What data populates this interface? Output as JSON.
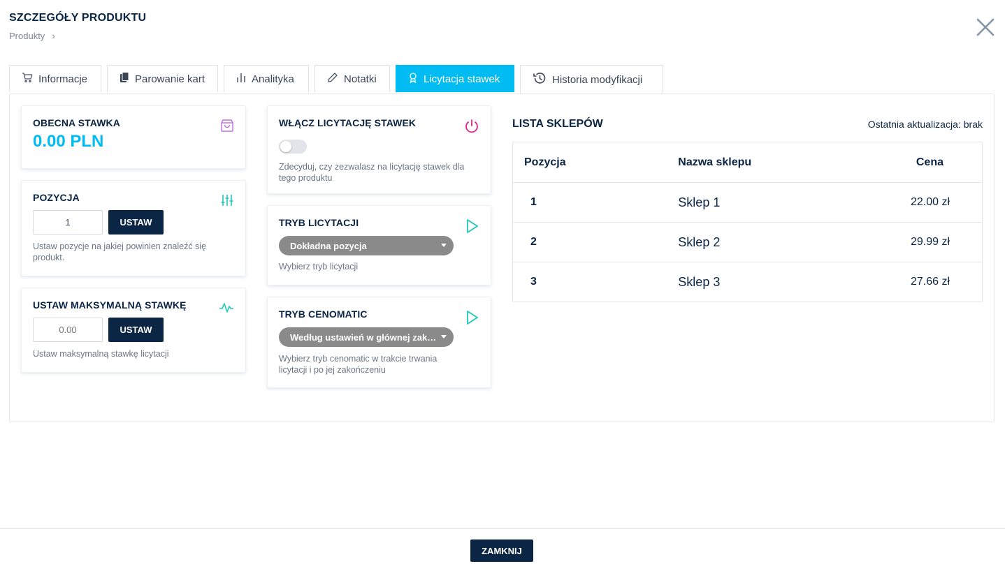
{
  "header": {
    "title": "SZCZEGÓŁY PRODUKTU",
    "breadcrumb": [
      "Produkty"
    ],
    "breadcrumb_separator": "›"
  },
  "tabs": [
    {
      "label": "Informacje",
      "icon": "cart-icon",
      "active": false
    },
    {
      "label": "Parowanie kart",
      "icon": "copy-icon",
      "active": false
    },
    {
      "label": "Analityka",
      "icon": "bar-chart-icon",
      "active": false
    },
    {
      "label": "Notatki",
      "icon": "pencil-icon",
      "active": false
    },
    {
      "label": "Licytacja stawek",
      "icon": "award-icon",
      "active": true
    },
    {
      "label": "Historia modyfikacji",
      "icon": "history-icon",
      "active": false
    }
  ],
  "current_bid": {
    "title": "OBECNA STAWKA",
    "value": "0.00 PLN",
    "icon": "shopping-bag-icon"
  },
  "position": {
    "title": "POZYCJA",
    "input_value": "1",
    "button_label": "USTAW",
    "help": "Ustaw pozycje na jakiej powinien znaleźć się produkt.",
    "icon": "sliders-icon"
  },
  "max_bid": {
    "title": "USTAW MAKSYMALNĄ STAWKĘ",
    "input_placeholder": "0.00",
    "button_label": "USTAW",
    "help": "Ustaw maksymalną stawkę licytacji",
    "icon": "activity-icon"
  },
  "enable_bidding": {
    "title": "WŁĄCZ LICYTACJĘ STAWEK",
    "enabled": false,
    "help": "Zdecyduj, czy zezwalasz na licytację stawek dla tego produktu",
    "icon": "power-icon"
  },
  "bidding_mode": {
    "title": "TRYB LICYTACJI",
    "selected": "Dokładna pozycja",
    "help": "Wybierz tryb licytacji",
    "icon": "play-icon"
  },
  "cenomatic_mode": {
    "title": "TRYB CENOMATIC",
    "selected": "Według ustawień w głównej zakładce",
    "help": "Wybierz tryb cenomatic w trakcie trwania licytacji i po jej zakończeniu",
    "icon": "play-icon"
  },
  "shop_list": {
    "title": "LISTA SKLEPÓW",
    "last_update_label": "Ostatnia aktualizacja:",
    "last_update_value": "brak",
    "columns": [
      "Pozycja",
      "Nazwa sklepu",
      "Cena"
    ],
    "rows": [
      {
        "position": "1",
        "shop": "Sklep 1",
        "price": "22.00 zł"
      },
      {
        "position": "2",
        "shop": "Sklep 2",
        "price": "29.99 zł"
      },
      {
        "position": "3",
        "shop": "Sklep 3",
        "price": "27.66 zł"
      }
    ]
  },
  "footer": {
    "close_label": "ZAMKNIJ"
  },
  "colors": {
    "accent": "#00bcf2",
    "navy": "#0b2545",
    "purple_icon": "#c06be8",
    "teal_icon": "#1ec8b4",
    "pink_icon": "#e0228a"
  }
}
